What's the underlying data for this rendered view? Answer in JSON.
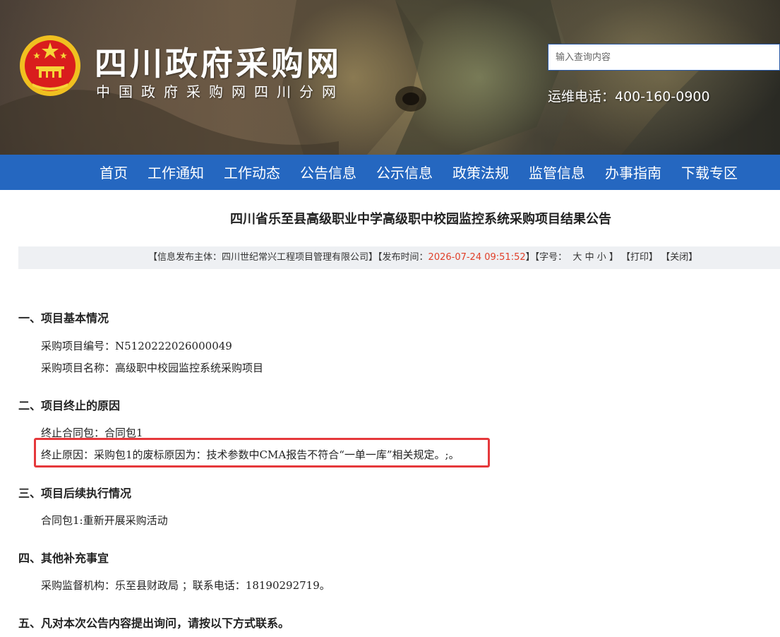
{
  "header": {
    "site_title": "四川政府采购网",
    "site_subtitle": "中国政府采购网四川分网",
    "search_placeholder": "输入查询内容",
    "hotline": "运维电话：400-160-0900"
  },
  "nav": {
    "items": [
      "首页",
      "工作通知",
      "工作动态",
      "公告信息",
      "公示信息",
      "政策法规",
      "监管信息",
      "办事指南",
      "下载专区"
    ]
  },
  "article": {
    "title": "四川省乐至县高级职业中学高级职中校园监控系统采购项目结果公告",
    "meta": {
      "publisher_prefix": "【信息发布主体：",
      "publisher": "四川世纪常兴工程项目管理有限公司",
      "publisher_suffix": "】【发布时间：",
      "date": "2026-07-24 09:51:52",
      "font_prefix": "】【字号：",
      "font_large": "大",
      "font_medium": "中",
      "font_small": "小",
      "font_suffix": "】",
      "print": "【打印】",
      "close": "【关闭】"
    },
    "sections": {
      "s1_title": "一、项目基本情况",
      "s1_line1": "采购项目编号：N5120222026000049",
      "s1_line2": "采购项目名称：高级职中校园监控系统采购项目",
      "s2_title": "二、项目终止的原因",
      "s2_line1": "终止合同包：合同包1",
      "s2_line2": "终止原因：采购包1的废标原因为：技术参数中CMA报告不符合“一单一库”相关规定。;。",
      "s3_title": "三、项目后续执行情况",
      "s3_line1": "合同包1:重新开展采购活动",
      "s4_title": "四、其他补充事宜",
      "s4_line1": "采购监督机构：乐至县财政局 ；联系电话：18190292719。",
      "s5_title": "五、凡对本次公告内容提出询问，请按以下方式联系。"
    }
  },
  "colors": {
    "nav_bg": "#2567c0",
    "date_text": "#e0402a",
    "highlight_border": "#e5383b",
    "meta_bg": "#eef0f3"
  }
}
